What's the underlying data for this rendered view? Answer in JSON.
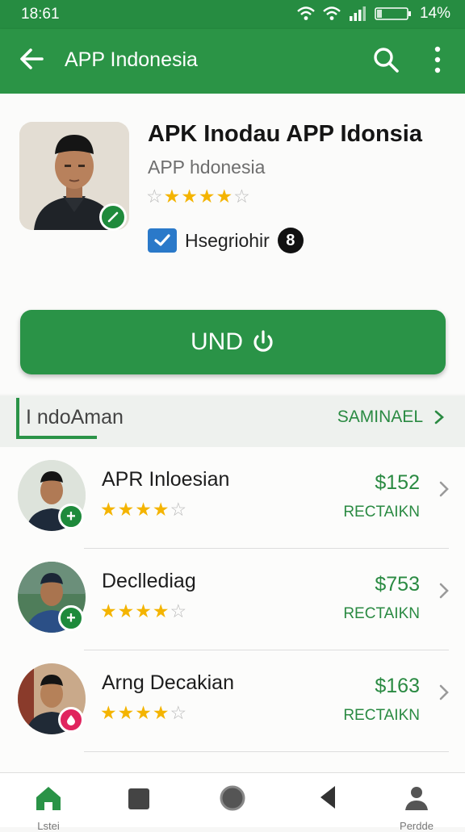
{
  "status": {
    "time": "18:61",
    "battery": "14%"
  },
  "appbar": {
    "title": "APP Indonesia",
    "icons": [
      "back-arrow-icon",
      "search-icon",
      "more-vert-icon"
    ]
  },
  "hero": {
    "title": "APK Inodau APP Idonsia",
    "subtitle": "APP hdonesia",
    "rating": 4,
    "rating_max": 5,
    "badge_label": "Hsegriohir",
    "badge_number": "8"
  },
  "install": {
    "label": "UND"
  },
  "section": {
    "title": "I ndoAman",
    "see_all": "SAMINAEL"
  },
  "items": [
    {
      "name": "APR Inloesian",
      "rating": 4,
      "price": "$152",
      "action": "RECTAIKN",
      "badge": "plus",
      "badge_color": "#1e8a3b"
    },
    {
      "name": "Declledіag",
      "rating": 4,
      "price": "$753",
      "action": "RECTAIKN",
      "badge": "plus",
      "badge_color": "#1e8a3b"
    },
    {
      "name": "Arng Decakian",
      "rating": 4,
      "price": "$163",
      "action": "RECTAIKN",
      "badge": "drop",
      "badge_color": "#e0245e"
    }
  ],
  "nav": [
    {
      "label": "Lstei",
      "icon": "home-icon"
    },
    {
      "label": "",
      "icon": "square-icon"
    },
    {
      "label": "",
      "icon": "circle-icon"
    },
    {
      "label": "",
      "icon": "triangle-back-icon"
    },
    {
      "label": "Perdde",
      "icon": "person-icon"
    }
  ],
  "colors": {
    "primary": "#2b9446",
    "accent_text": "#2a8a42",
    "star": "#f4b400"
  }
}
